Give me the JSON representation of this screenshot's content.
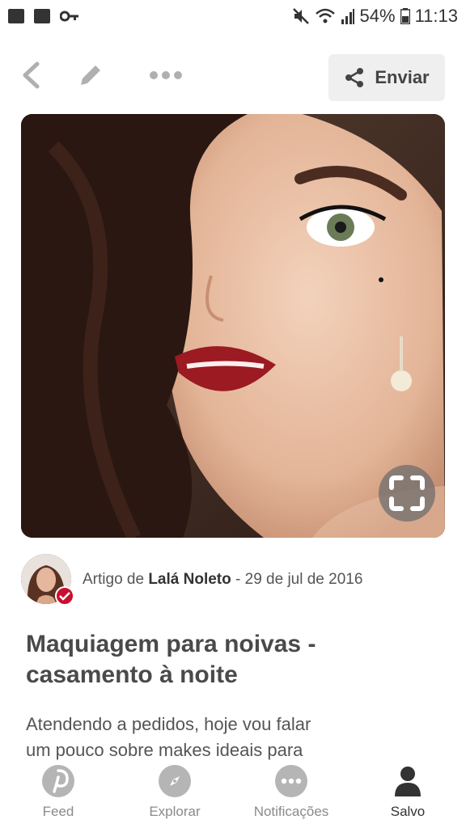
{
  "status_bar": {
    "battery": "54%",
    "time": "11:13"
  },
  "top_bar": {
    "send_label": "Enviar"
  },
  "attribution": {
    "prefix": "Artigo de ",
    "author": "Lalá Noleto",
    "separator": " - ",
    "date": "29 de jul de 2016"
  },
  "pin": {
    "title_line1": "Maquiagem para noivas -",
    "title_line2": "casamento à noite",
    "desc_line1": "Atendendo a pedidos, hoje vou falar",
    "desc_line2": "um pouco sobre makes ideais para"
  },
  "bottom_nav": {
    "items": [
      {
        "label": "Feed",
        "icon": "pinterest-icon"
      },
      {
        "label": "Explorar",
        "icon": "compass-icon"
      },
      {
        "label": "Notificações",
        "icon": "chat-bubble-icon"
      },
      {
        "label": "Salvo",
        "icon": "person-icon"
      }
    ],
    "active_index": 3
  },
  "colors": {
    "accent_red": "#c8102e",
    "nav_inactive": "#b5b5b5"
  }
}
